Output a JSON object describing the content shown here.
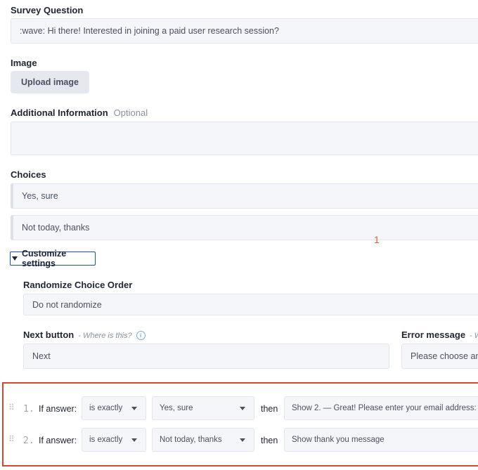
{
  "survey_question": {
    "label": "Survey Question",
    "value": ":wave: Hi there! Interested in joining a paid user research session?"
  },
  "image": {
    "label": "Image",
    "upload_label": "Upload image"
  },
  "additional_info": {
    "label": "Additional Information",
    "optional": "Optional",
    "value": ""
  },
  "choices": {
    "label": "Choices",
    "items": [
      "Yes, sure",
      "Not today, thanks"
    ]
  },
  "marker_text": "1",
  "customize": {
    "toggle_label": "Customize settings",
    "randomize": {
      "label": "Randomize Choice Order",
      "value": "Do not randomize"
    },
    "next_button": {
      "label": "Next button",
      "hint": "- Where is this?",
      "value": "Next"
    },
    "error_message": {
      "label": "Error message",
      "hint": "- Whe",
      "value": "Please choose an"
    }
  },
  "logic": {
    "if_label": "If answer:",
    "then_label": "then",
    "rows": [
      {
        "num": "1.",
        "operator": "is exactly",
        "answer": "Yes, sure",
        "action": "Show 2. — Great! Please enter your email address:"
      },
      {
        "num": "2.",
        "operator": "is exactly",
        "answer": "Not today, thanks",
        "action": "Show thank you message"
      }
    ]
  },
  "icons": {
    "info": "info-icon",
    "caret": "caret-down-icon",
    "drag": "drag-handle-icon"
  },
  "colors": {
    "highlight_border": "#d9452f",
    "focus_border": "#1f4fa0",
    "field_bg": "#f5f6fa"
  }
}
